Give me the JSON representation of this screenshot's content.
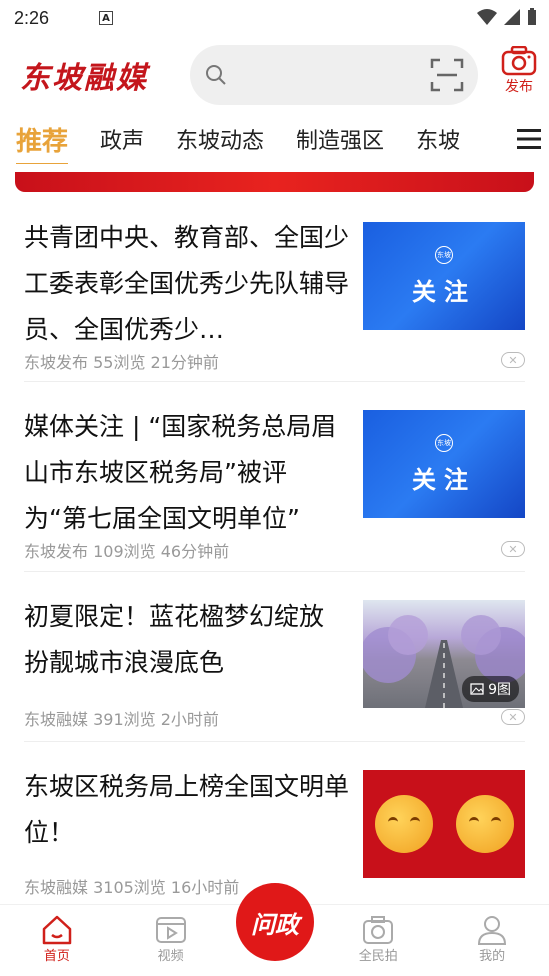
{
  "status": {
    "time": "2:26"
  },
  "header": {
    "logo": "东坡融媒",
    "publish_label": "发布"
  },
  "tabs": [
    "推荐",
    "政声",
    "东坡动态",
    "制造强区",
    "东坡"
  ],
  "feed": [
    {
      "title": "共青团中央、教育部、全国少工委表彰全国优秀少先队辅导员、全国优秀少…",
      "meta": "东坡发布 55浏览 21分钟前",
      "thumb_text": "关注",
      "thumb_badge": "东坡"
    },
    {
      "title": "媒体关注 | “国家税务总局眉山市东坡区税务局”被评为“第七届全国文明单位”",
      "meta": "东坡发布 109浏览 46分钟前",
      "thumb_text": "关注",
      "thumb_badge": "东坡"
    },
    {
      "title": "初夏限定！蓝花楹梦幻绽放 扮靓城市浪漫底色",
      "meta": "东坡融媒 391浏览 2小时前",
      "image_count": "9图"
    },
    {
      "title": "东坡区税务局上榜全国文明单位！",
      "meta": "东坡融媒 3105浏览 16小时前"
    }
  ],
  "bottom_nav": {
    "home": "首页",
    "video": "视频",
    "center": "问政",
    "snap": "全民拍",
    "mine": "我的"
  },
  "colors": {
    "brand_red": "#d0201a",
    "tab_active": "#e8a33a"
  }
}
